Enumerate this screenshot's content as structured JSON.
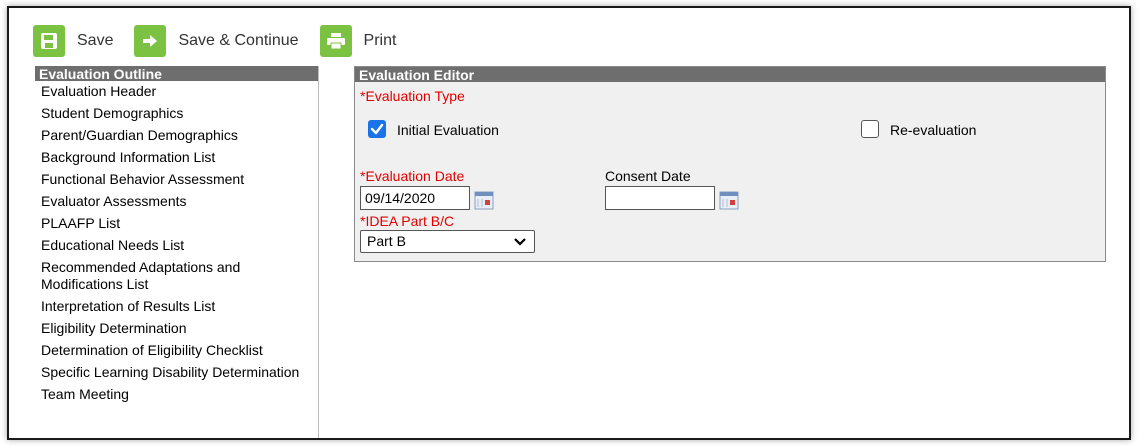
{
  "toolbar": {
    "save_label": "Save",
    "save_continue_label": "Save & Continue",
    "print_label": "Print",
    "icon_color": "#7cc242"
  },
  "outline": {
    "title": "Evaluation Outline",
    "items": [
      "Evaluation Header",
      "Student Demographics",
      "Parent/Guardian Demographics",
      "Background Information List",
      "Functional Behavior Assessment",
      "Evaluator Assessments",
      "PLAAFP List",
      "Educational Needs List",
      "Recommended Adaptations and Modifications List",
      "Interpretation of Results List",
      "Eligibility Determination",
      "Determination of Eligibility Checklist",
      "Specific Learning Disability Determination",
      "Team Meeting"
    ]
  },
  "editor": {
    "title": "Evaluation Editor",
    "evaluation_type_label": "*Evaluation Type",
    "initial_evaluation_label": "Initial Evaluation",
    "initial_evaluation_checked": true,
    "reevaluation_label": "Re-evaluation",
    "reevaluation_checked": false,
    "evaluation_date_label": "*Evaluation Date",
    "evaluation_date_value": "09/14/2020",
    "consent_date_label": "Consent Date",
    "consent_date_value": "",
    "idea_part_label": "*IDEA Part B/C",
    "idea_part_value": "Part B",
    "required_color": "#e00000",
    "header_color": "#6e6e6e",
    "check_color": "#1a73e8"
  }
}
